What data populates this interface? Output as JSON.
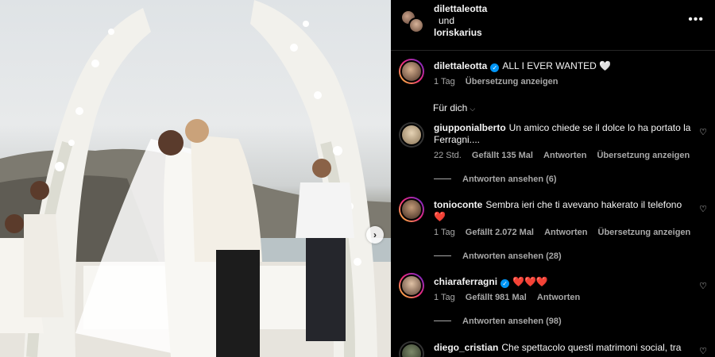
{
  "header": {
    "user1": "dilettaleotta",
    "joiner": "und",
    "user2": "loriskarius",
    "more_icon": "more-horizontal-icon"
  },
  "caption": {
    "username": "dilettaleotta",
    "verified": true,
    "text": "ALL I EVER WANTED 🤍",
    "time": "1 Tag",
    "translate": "Übersetzung anzeigen"
  },
  "sort": {
    "label": "Für dich"
  },
  "comments": [
    {
      "username": "giupponialberto",
      "text": "Un amico chiede se il dolce lo ha portato la Ferragni....",
      "time": "22 Std.",
      "likes": "Gefällt 135 Mal",
      "reply": "Antworten",
      "translate": "Übersetzung anzeigen",
      "view_replies": "Antworten ansehen (6)"
    },
    {
      "username": "tonioconte",
      "text": "Sembra ieri che ti avevano hakerato il telefono ❤️",
      "time": "1 Tag",
      "likes": "Gefällt 2.072 Mal",
      "reply": "Antworten",
      "translate": "Übersetzung anzeigen",
      "view_replies": "Antworten ansehen (28)"
    },
    {
      "username": "chiaraferragni",
      "verified": true,
      "text": "❤️❤️❤️",
      "time": "1 Tag",
      "likes": "Gefällt 981 Mal",
      "reply": "Antworten",
      "view_replies": "Antworten ansehen (98)"
    },
    {
      "username": "diego_cristian",
      "text": "Che spettacolo questi matrimoni social, tra"
    }
  ],
  "colors": {
    "accent": "#0095f6",
    "muted": "#a8a8a8",
    "background": "#000000"
  }
}
